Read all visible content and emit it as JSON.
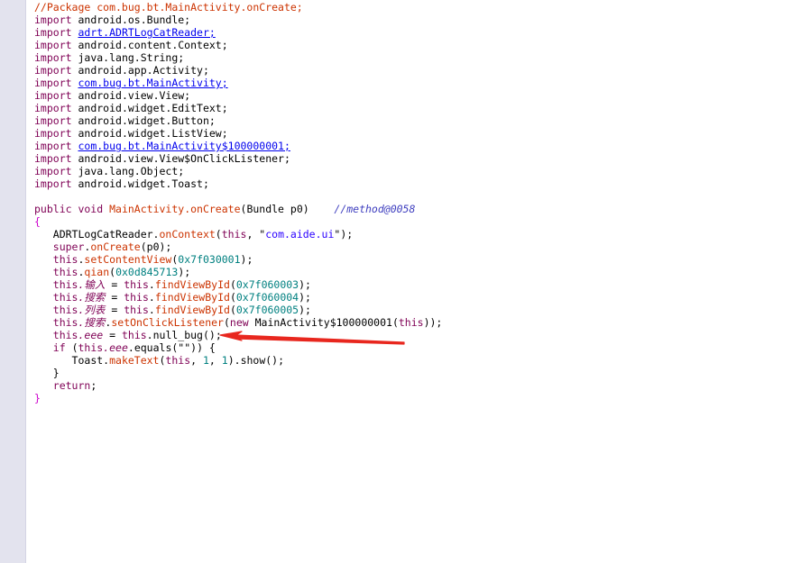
{
  "colors": {
    "keyword": "#7f0055",
    "comment": "#cc3300",
    "link": "#0000ee",
    "number": "#008080",
    "string": "#2a00ff",
    "brace": "#cc00cc",
    "arrow": "#e8271e",
    "gutter": "#e3e3ee"
  },
  "code": {
    "package_comment": "//Package com.bug.bt.MainActivity.onCreate;",
    "imports": [
      {
        "kw": "import",
        "name": "android.os.Bundle;",
        "link": false
      },
      {
        "kw": "import",
        "name": "adrt.ADRTLogCatReader;",
        "link": true
      },
      {
        "kw": "import",
        "name": "android.content.Context;",
        "link": false
      },
      {
        "kw": "import",
        "name": "java.lang.String;",
        "link": false
      },
      {
        "kw": "import",
        "name": "android.app.Activity;",
        "link": false
      },
      {
        "kw": "import",
        "name": "com.bug.bt.MainActivity;",
        "link": true
      },
      {
        "kw": "import",
        "name": "android.view.View;",
        "link": false
      },
      {
        "kw": "import",
        "name": "android.widget.EditText;",
        "link": false
      },
      {
        "kw": "import",
        "name": "android.widget.Button;",
        "link": false
      },
      {
        "kw": "import",
        "name": "android.widget.ListView;",
        "link": false
      },
      {
        "kw": "import",
        "name": "com.bug.bt.MainActivity$100000001;",
        "link": true
      },
      {
        "kw": "import",
        "name": "android.view.View$OnClickListener;",
        "link": false
      },
      {
        "kw": "import",
        "name": "java.lang.Object;",
        "link": false
      },
      {
        "kw": "import",
        "name": "android.widget.Toast;",
        "link": false
      }
    ],
    "method_sig": {
      "mods": "public void",
      "name": "MainActivity.onCreate",
      "params": "(Bundle p0)",
      "comment": "//method@0058"
    },
    "open_brace": "{",
    "close_brace": "}",
    "inner_close_brace": "}",
    "body": {
      "l1_a": "ADRTLogCatReader.",
      "l1_fn": "onContext",
      "l1_b": "(",
      "l1_this": "this",
      "l1_c": ", \"",
      "l1_str": "com.aide.ui",
      "l1_d": "\");",
      "l2_kw": "super",
      "l2_a": ".",
      "l2_fn": "onCreate",
      "l2_b": "(p0);",
      "l3_this": "this",
      "l3_a": ".",
      "l3_fn": "setContentView",
      "l3_b": "(",
      "l3_num": "0x7f030001",
      "l3_c": ");",
      "l4_this": "this",
      "l4_a": ".",
      "l4_fn": "qian",
      "l4_b": "(",
      "l4_num": "0x0d845713",
      "l4_c": ");",
      "l5_this": "this",
      "l5_var": ".输入",
      "l5_a": " = ",
      "l5_this2": "this",
      "l5_b": ".",
      "l5_fn": "findViewById",
      "l5_c": "(",
      "l5_num": "0x7f060003",
      "l5_d": ");",
      "l6_this": "this",
      "l6_var": ".搜索",
      "l6_a": " = ",
      "l6_this2": "this",
      "l6_b": ".",
      "l6_fn": "findViewById",
      "l6_c": "(",
      "l6_num": "0x7f060004",
      "l6_d": ");",
      "l7_this": "this",
      "l7_var": ".列表",
      "l7_a": " = ",
      "l7_this2": "this",
      "l7_b": ".",
      "l7_fn": "findViewById",
      "l7_c": "(",
      "l7_num": "0x7f060005",
      "l7_d": ");",
      "l8_this": "this",
      "l8_var": ".搜索",
      "l8_a": ".",
      "l8_fn": "setOnClickListener",
      "l8_b": "(",
      "l8_new": "new",
      "l8_c": " MainActivity$100000001(",
      "l8_this2": "this",
      "l8_d": "));",
      "l9_this": "this",
      "l9_var": ".eee",
      "l9_a": " = ",
      "l9_this2": "this",
      "l9_b": ".null_bug();",
      "l10_kw": "if",
      "l10_a": " (",
      "l10_this": "this",
      "l10_var": ".eee",
      "l10_b": ".equals(\"\")) {",
      "l11_a": "Toast.",
      "l11_fn": "makeText",
      "l11_b": "(",
      "l11_this": "this",
      "l11_c": ", ",
      "l11_n1": "1",
      "l11_d": ", ",
      "l11_n2": "1",
      "l11_e": ").show();",
      "l12_kw": "return",
      "l12_a": ";"
    }
  }
}
